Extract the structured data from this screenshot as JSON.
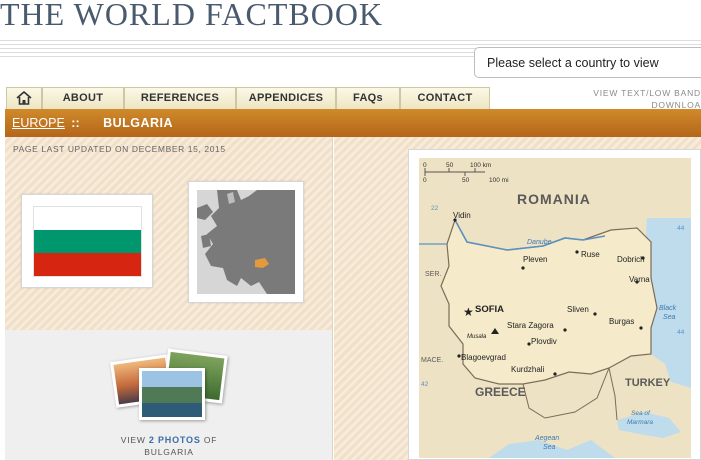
{
  "header": {
    "logo_text": "THE WORLD FACTBOOK",
    "country_select_placeholder": "Please select a country to view"
  },
  "nav": {
    "home_icon": "home-icon",
    "tabs": [
      {
        "label": "ABOUT"
      },
      {
        "label": "REFERENCES"
      },
      {
        "label": "APPENDICES"
      },
      {
        "label": "FAQs"
      },
      {
        "label": "CONTACT"
      }
    ],
    "view_text_line1": "VIEW TEXT/LOW BAND",
    "view_text_line2": "DOWNLOA"
  },
  "breadcrumb": {
    "region": "EUROPE",
    "separator": "::",
    "country": "BULGARIA"
  },
  "page_updated": "PAGE LAST UPDATED ON DECEMBER 15, 2015",
  "flag_colors": [
    "#ffffff",
    "#00966e",
    "#d62612"
  ],
  "photos": {
    "prefix": "VIEW",
    "count": "2 PHOTOS",
    "suffix": "OF",
    "country": "BULGARIA"
  },
  "map": {
    "scale": {
      "km_ticks": [
        "0",
        "50",
        "100 km"
      ],
      "mi_ticks": [
        "0",
        "50",
        "100 mi"
      ]
    },
    "countries": {
      "romania": "ROMANIA",
      "serbia": "SER.",
      "macedonia": "MACE.",
      "greece": "GREECE",
      "turkey": "TURKEY"
    },
    "water": {
      "danube": "Danube",
      "black_sea_1": "Black",
      "black_sea_2": "Sea",
      "sea_of_marmara_1": "Sea of",
      "sea_of_marmara_2": "Marmara",
      "aegean_1": "Aegean",
      "aegean_2": "Sea"
    },
    "cities": {
      "capital": "SOFIA",
      "vidin": "Vidin",
      "ruse": "Ruse",
      "dobrich": "Dobrich",
      "varna": "Varna",
      "pleven": "Pleven",
      "sliven": "Sliven",
      "burgas": "Burgas",
      "stara_zagora": "Stara Zagora",
      "plovdiv": "Plovdiv",
      "musala": "Musala",
      "blagoevgrad": "Blagoevgrad",
      "kurdzhali": "Kurdzhali"
    },
    "grid_numbers": {
      "top_left": "22",
      "top_right": "44",
      "mid_right": "44",
      "bottom_left": "42"
    },
    "colors": {
      "land": "#f5ebcb",
      "neighbor": "#ede2c4",
      "sea": "#bfdcec",
      "border": "#7d6b58"
    }
  }
}
